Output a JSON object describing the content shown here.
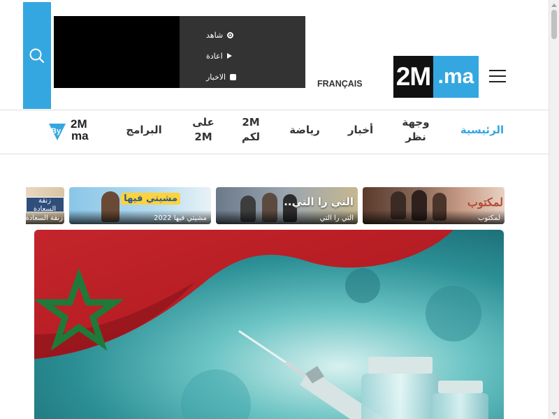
{
  "header": {
    "lang_switch": "FRANÇAIS",
    "logo": {
      "left": "2M",
      "right": ".ma"
    },
    "colors": {
      "accent": "#34a7e0",
      "dark": "#111111",
      "player_bg": "#333333"
    },
    "player_menu": [
      {
        "label": "شاهد",
        "icon": "radio-dot-icon"
      },
      {
        "label": "اعادة",
        "icon": "play-icon"
      },
      {
        "label": "الاخبار",
        "icon": "news-icon"
      }
    ]
  },
  "nav": {
    "items": [
      {
        "label": "الرئيسية",
        "active": true
      },
      {
        "label": "وجهة نظر"
      },
      {
        "label": "أخبار"
      },
      {
        "label": "رياضة"
      },
      {
        "label": "2M لكم"
      },
      {
        "label": "على 2M"
      },
      {
        "label": "البرامج"
      }
    ],
    "byme": {
      "top": "2M",
      "bottom": "ma",
      "mark": "By"
    }
  },
  "shows": [
    {
      "caption": "لمكتوب",
      "overlay": "لمكتوب"
    },
    {
      "caption": "التي را التي",
      "overlay": "التي را التي.."
    },
    {
      "caption": "مشيتي فيها 2022",
      "overlay": "مشيتي فيها"
    },
    {
      "caption": "زنقة السعادة",
      "overlay": "زنقة السعادة"
    }
  ]
}
